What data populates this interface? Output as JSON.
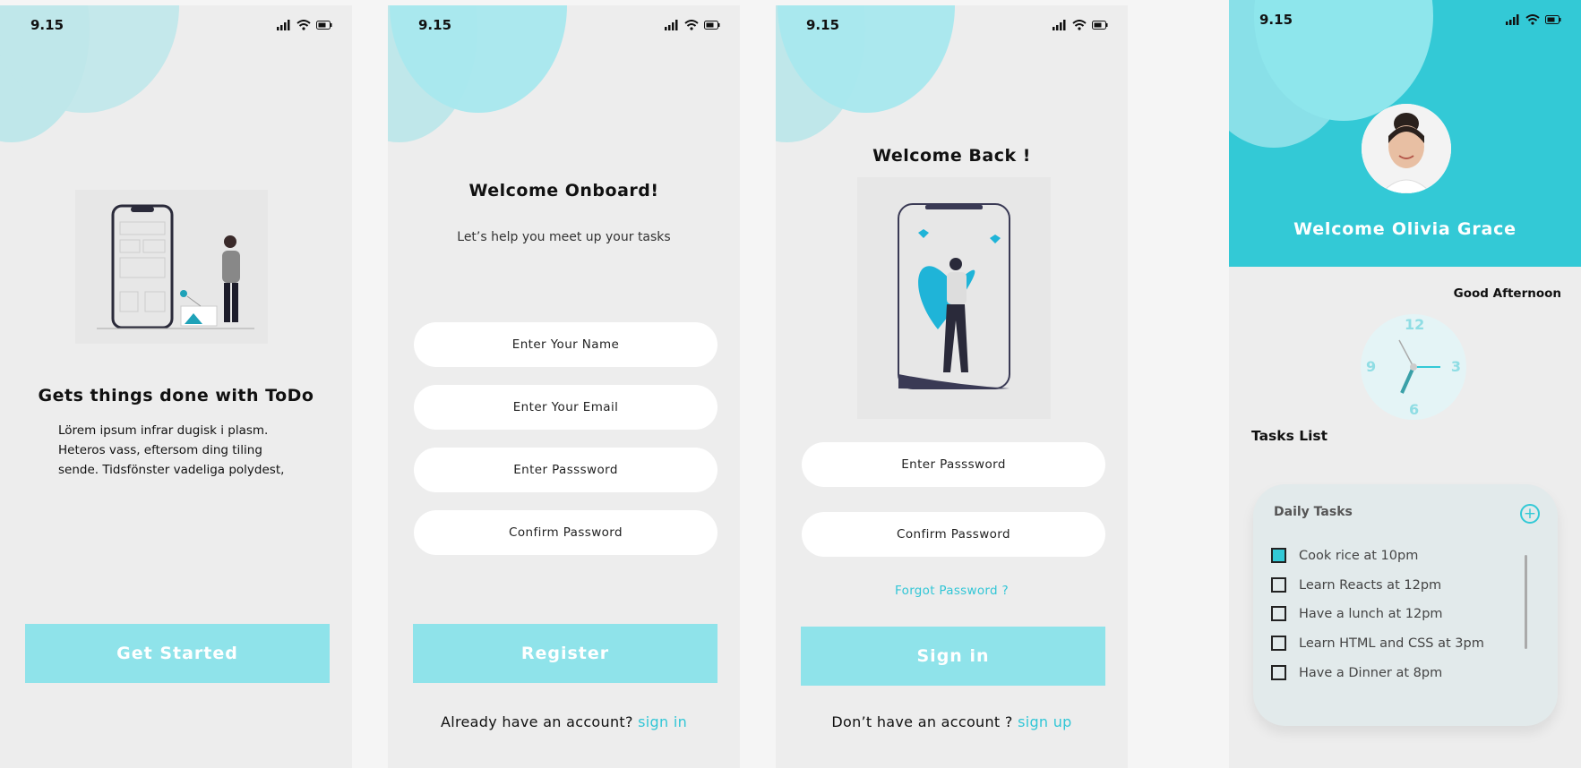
{
  "status": {
    "time": "9.15"
  },
  "screen1": {
    "title": "Gets things done with ToDo",
    "paragraph": [
      "Lörem ipsum infrar dugisk i plasm.",
      "Heteros vass, eftersom ding tiling",
      "sende. Tidsfönster vadeliga polydest,"
    ],
    "button": "Get Started"
  },
  "screen2": {
    "title": "Welcome Onboard!",
    "subtitle": "Let’s help you meet up your tasks",
    "inputs": {
      "name": "Enter Your Name",
      "email": "Enter Your Email",
      "password": "Enter Passsword",
      "confirm": "Confirm Password"
    },
    "button": "Register",
    "footer_text": "Already have an account?",
    "footer_link": "sign in"
  },
  "screen3": {
    "title": "Welcome Back !",
    "inputs": {
      "password": "Enter Passsword",
      "confirm": "Confirm Password"
    },
    "forgot": "Forgot Password ?",
    "button": "Sign in",
    "footer_text": "Don’t have an account ?",
    "footer_link": "sign up"
  },
  "screen4": {
    "welcome": "Welcome Olivia Grace",
    "greeting": "Good Afternoon",
    "clock_numbers": {
      "twelve": "12",
      "three": "3",
      "six": "6",
      "nine": "9"
    },
    "tasks_list_title": "Tasks List",
    "card_title": "Daily Tasks",
    "tasks": [
      {
        "label": "Cook rice at 10pm",
        "checked": true
      },
      {
        "label": "Learn Reacts at 12pm",
        "checked": false
      },
      {
        "label": "Have a lunch at 12pm",
        "checked": false
      },
      {
        "label": "Learn HTML and CSS at 3pm",
        "checked": false
      },
      {
        "label": "Have a Dinner at 8pm",
        "checked": false
      }
    ]
  },
  "colors": {
    "accent": "#33c9d6",
    "button": "#8fe3ea",
    "background": "#ededed"
  },
  "icons": [
    "signal-icon",
    "wifi-icon",
    "battery-icon",
    "plus-circle-icon",
    "checkbox-icon"
  ]
}
